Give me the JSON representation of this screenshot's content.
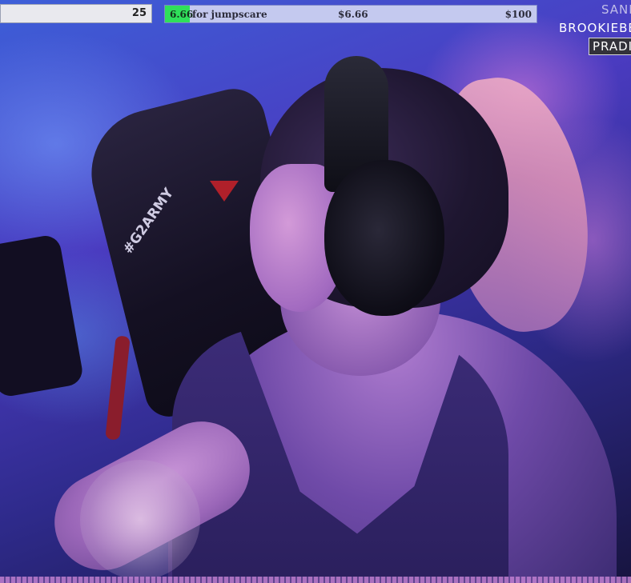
{
  "overlay": {
    "counter": {
      "value": "25"
    },
    "goal": {
      "amount_label": "6.66",
      "label": "for jumpscare",
      "current": "$6.66",
      "target": "$100",
      "progress_fraction": 0.0666,
      "fill_color": "#2fe05a"
    },
    "names": [
      "SANI",
      "BROOKIEBE",
      "PRADI"
    ]
  },
  "scene": {
    "chair_text": "#G2ARMY"
  },
  "icons": {
    "chair_logo": "chair-brand-logo-icon"
  }
}
